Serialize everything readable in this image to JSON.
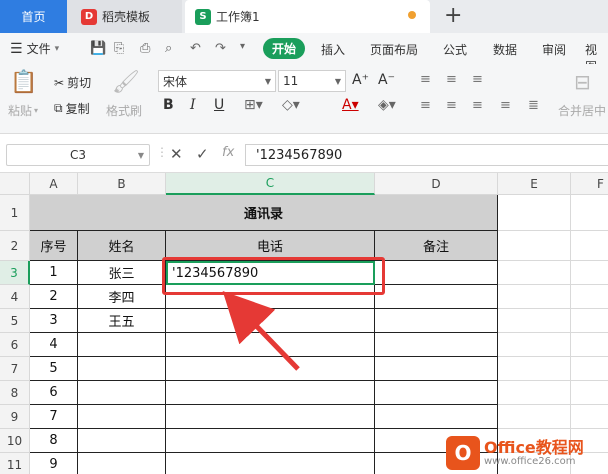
{
  "tabs": {
    "home": "首页",
    "daoke": "稻壳模板",
    "workbook": "工作簿1",
    "daoke_icon": "D",
    "book_icon": "S",
    "add": "+"
  },
  "menu": {
    "file": "文件",
    "start": "开始",
    "items": [
      "插入",
      "页面布局",
      "公式",
      "数据",
      "审阅",
      "视图"
    ]
  },
  "ribbon": {
    "paste": "粘贴",
    "cut": "剪切",
    "copy": "复制",
    "format_painter": "格式刷",
    "font_name": "宋体",
    "font_size": "11",
    "bold": "B",
    "italic": "I",
    "underline": "U",
    "merge_center": "合并居中"
  },
  "formula_bar": {
    "name_box": "C3",
    "content": "'1234567890"
  },
  "columns": [
    "A",
    "B",
    "C",
    "D",
    "E",
    "F"
  ],
  "rows": [
    "1",
    "2",
    "3",
    "4",
    "5",
    "6",
    "7",
    "8",
    "9",
    "10",
    "11"
  ],
  "table": {
    "title": "通讯录",
    "headers": [
      "序号",
      "姓名",
      "电话",
      "备注"
    ],
    "data": [
      [
        "1",
        "张三",
        "'1234567890",
        ""
      ],
      [
        "2",
        "李四",
        "",
        ""
      ],
      [
        "3",
        "王五",
        "",
        ""
      ],
      [
        "4",
        "",
        "",
        ""
      ],
      [
        "5",
        "",
        "",
        ""
      ],
      [
        "6",
        "",
        "",
        ""
      ],
      [
        "7",
        "",
        "",
        ""
      ],
      [
        "8",
        "",
        "",
        ""
      ],
      [
        "9",
        "",
        "",
        ""
      ]
    ]
  },
  "watermark": {
    "main": "Office教程网",
    "url": "www.office26.com"
  },
  "colors": {
    "accent_green": "#1a9e5b",
    "annotation_red": "#e53935",
    "home_tab_blue": "#2f7de1"
  }
}
